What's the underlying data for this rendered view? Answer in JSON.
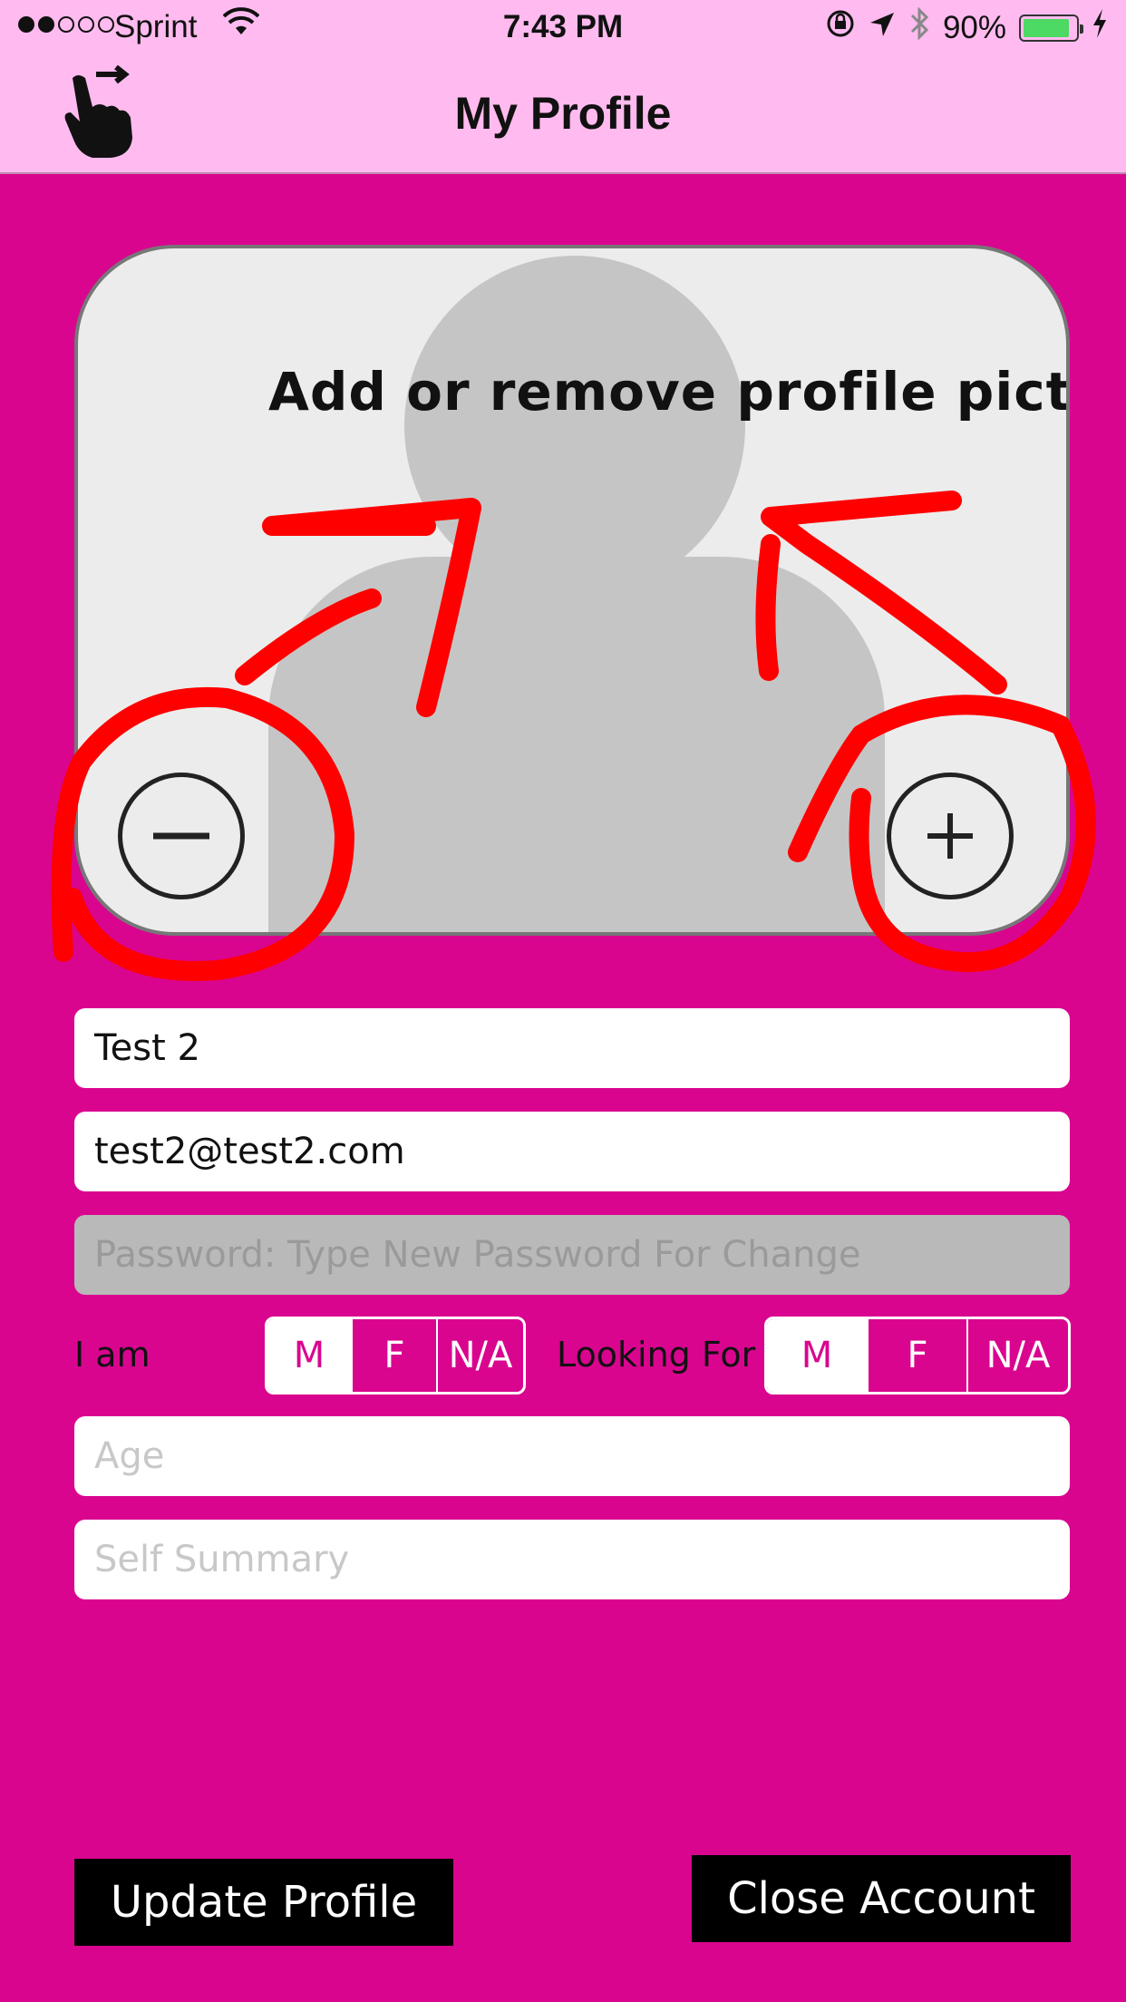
{
  "status_bar": {
    "carrier": "Sprint",
    "time": "7:43 PM",
    "battery": "90%",
    "battery_level": 0.9
  },
  "nav": {
    "title": "My Profile",
    "icon": "hand-pointer-icon"
  },
  "photo": {
    "hint": "Add or remove profile picture",
    "remove_icon": "minus-circle-icon",
    "add_icon": "plus-circle-icon"
  },
  "form": {
    "name_value": "Test 2",
    "email_value": "test2@test2.com",
    "password_placeholder": "Password: Type New Password For Change",
    "i_am_label": "I am",
    "i_am_options": [
      "M",
      "F",
      "N/A"
    ],
    "i_am_selected": "M",
    "looking_for_label": "Looking For",
    "looking_for_options": [
      "M",
      "F",
      "N/A"
    ],
    "looking_for_selected": "M",
    "age_placeholder": "Age",
    "summary_placeholder": "Self Summary"
  },
  "actions": {
    "update_label": "Update Profile",
    "close_label": "Close Account"
  },
  "colors": {
    "background": "#d9058f",
    "nav_bar": "#ffbbef",
    "annotation": "#ff0000"
  }
}
